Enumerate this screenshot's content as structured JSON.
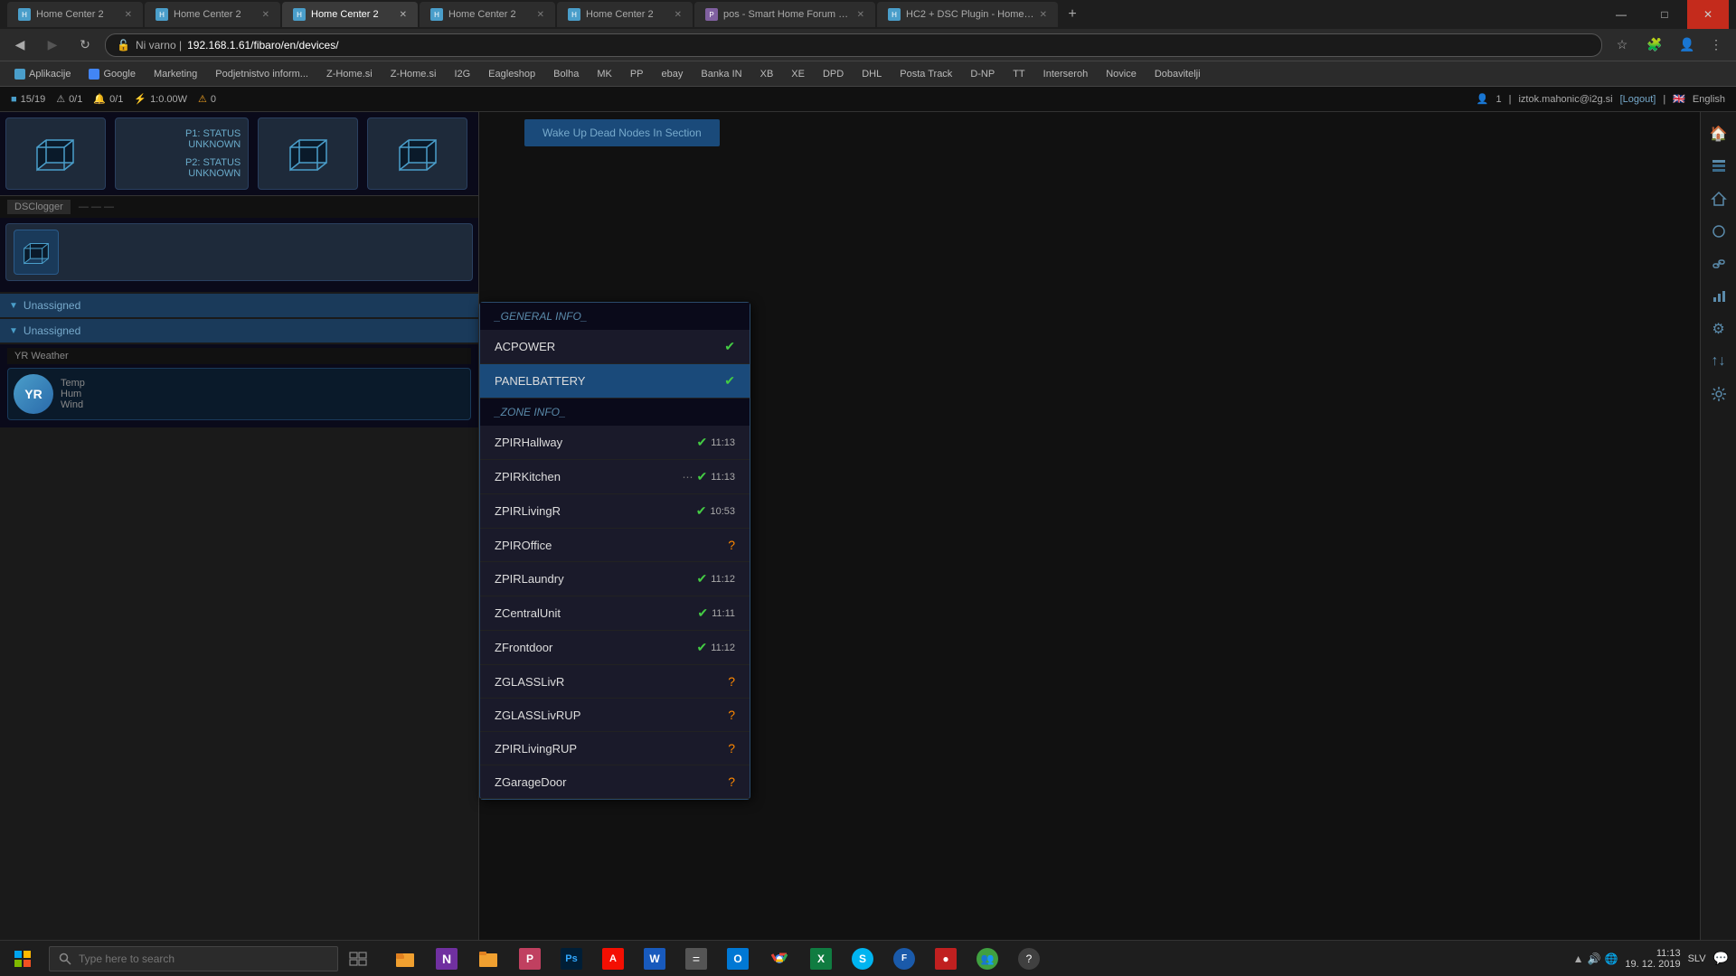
{
  "browser": {
    "tabs": [
      {
        "id": 1,
        "label": "Home Center 2",
        "active": false,
        "favicon": "HC"
      },
      {
        "id": 2,
        "label": "Home Center 2",
        "active": false,
        "favicon": "HC"
      },
      {
        "id": 3,
        "label": "Home Center 2",
        "active": true,
        "favicon": "HC"
      },
      {
        "id": 4,
        "label": "Home Center 2",
        "active": false,
        "favicon": "HC"
      },
      {
        "id": 5,
        "label": "Home Center 2",
        "active": false,
        "favicon": "HC"
      },
      {
        "id": 6,
        "label": "pos - Smart Home Forum by FIB...",
        "active": false,
        "favicon": "P"
      },
      {
        "id": 7,
        "label": "HC2 + DSC Plugin - Home Cent...",
        "active": false,
        "favicon": "HC"
      }
    ],
    "url": "192.168.1.61/fibaro/en/devices/",
    "url_prefix": "Ni varno | "
  },
  "bookmarks": [
    "Aplikacije",
    "Google",
    "Marketing",
    "Podjetnistvo inform...",
    "Z-Home.si",
    "Z-Home.si",
    "I2G",
    "Eagleshop",
    "Bolha",
    "MK",
    "PP",
    "ebay",
    "Banka IN",
    "XB",
    "XE",
    "DPD",
    "DHL",
    "Posta Track",
    "D-NP",
    "TT",
    "Interseroh",
    "Novice",
    "Dobavitelji"
  ],
  "hc2_status": {
    "devices_count": "15/19",
    "warnings": "0/1",
    "alerts": "0/1",
    "power": "1:0.00W",
    "warning_icon": "⚠",
    "warning_count": "0"
  },
  "user": {
    "name": "iztok.mahonic@i2g.si",
    "logout_label": "[Logout]",
    "language": "English",
    "user_count": "1"
  },
  "devices_panel": {
    "dsc_logger_label": "DSClogger",
    "unassigned_label": "Unassigned",
    "yr_weather_label": "YR Weather",
    "yr_items": [
      "Temp",
      "Hum",
      "Wind"
    ]
  },
  "dropdown_menu": {
    "header_general": "_GENERAL INFO_",
    "items": [
      {
        "name": "ACPOWER",
        "status": "ok",
        "time": ""
      },
      {
        "name": "PANELBATTERY",
        "status": "ok",
        "time": "",
        "highlighted": true
      },
      {
        "name": "_ZONE INFO_",
        "is_header": true
      },
      {
        "name": "ZPIRHallway",
        "status": "ok",
        "time": "11:13"
      },
      {
        "name": "ZPIRKitchen",
        "status": "ok",
        "time": "11:13"
      },
      {
        "name": "ZPIRLivingR",
        "status": "ok",
        "time": "10:53"
      },
      {
        "name": "ZPIROffice",
        "status": "unknown",
        "time": ""
      },
      {
        "name": "ZPIRLaundry",
        "status": "ok",
        "time": "11:12"
      },
      {
        "name": "ZCentralUnit",
        "status": "ok",
        "time": "11:11"
      },
      {
        "name": "ZFrontdoor",
        "status": "ok",
        "time": "11:12"
      },
      {
        "name": "ZGLASSLivR",
        "status": "unknown",
        "time": ""
      },
      {
        "name": "ZGLASSLivRUP",
        "status": "unknown",
        "time": ""
      },
      {
        "name": "ZPIRLivingRUP",
        "status": "unknown",
        "time": ""
      },
      {
        "name": "ZGarageDoor",
        "status": "unknown",
        "time": ""
      }
    ]
  },
  "right_panel": {
    "wake_btn_label": "Wake Up Dead Nodes In Section"
  },
  "right_sidebar_icons": [
    "🏠",
    "📊",
    "🏠",
    "🔵",
    "🔗",
    "📈",
    "⚙",
    "↑↓",
    "⚙"
  ],
  "taskbar": {
    "search_placeholder": "Type here to search",
    "time": "11:13",
    "date": "19. 12. 2019",
    "language": "SLV",
    "apps": [
      {
        "icon": "🗂",
        "color": "#e8a020"
      },
      {
        "icon": "🟠",
        "color": "#e05010"
      },
      {
        "icon": "📁",
        "color": "#f0a030"
      },
      {
        "icon": "🎭",
        "color": "#c04080"
      },
      {
        "icon": "🅿",
        "color": "#5060c0"
      },
      {
        "icon": "📄",
        "color": "#d04020"
      },
      {
        "icon": "W",
        "color": "#2050c0"
      },
      {
        "icon": "🖩",
        "color": "#606060"
      },
      {
        "icon": "📧",
        "color": "#2080c0"
      },
      {
        "icon": "🌐",
        "color": "#30a030"
      },
      {
        "icon": "📊",
        "color": "#107020"
      },
      {
        "icon": "💬",
        "color": "#1a6aaa"
      },
      {
        "icon": "🦊",
        "color": "#e05010"
      },
      {
        "icon": "🔴",
        "color": "#c02020"
      },
      {
        "icon": "👥",
        "color": "#505050"
      },
      {
        "icon": "❓",
        "color": "#808080"
      }
    ]
  }
}
